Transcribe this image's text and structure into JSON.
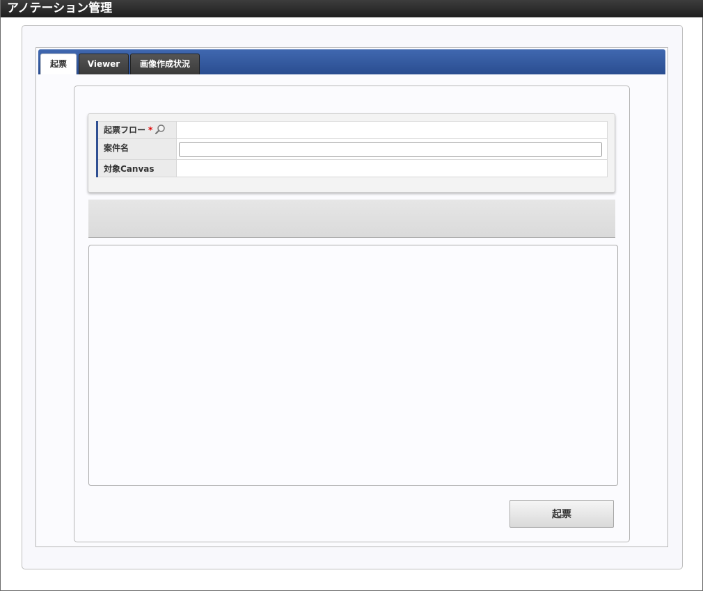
{
  "window": {
    "title": "アノテーション管理"
  },
  "tabs": [
    {
      "label": "起票",
      "active": true
    },
    {
      "label": "Viewer",
      "active": false
    },
    {
      "label": "画像作成状況",
      "active": false
    }
  ],
  "form": {
    "flow_label": "起票フロー",
    "required_mark": "*",
    "flow_value": "",
    "subject_label": "案件名",
    "subject_value": "",
    "canvas_label": "対象Canvas",
    "canvas_value": ""
  },
  "actions": {
    "submit_label": "起票"
  },
  "colors": {
    "titlebar": "#2a2a2a",
    "tabbar": "#2f4f92",
    "required": "#e00000"
  },
  "icons": {
    "flow_search": "search-icon"
  }
}
